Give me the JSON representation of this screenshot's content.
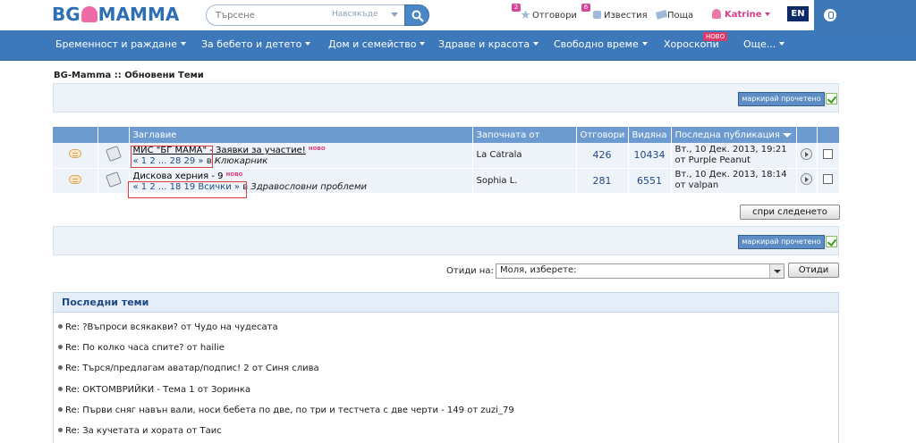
{
  "header": {
    "logo_text_left": "BG",
    "logo_text_right": "MAMMA",
    "search_placeholder": "Търсене",
    "search_scope": "Навсякъде",
    "replies_label": "Отговори",
    "replies_count": "2",
    "notifications_label": "Известия",
    "notifications_count": "6",
    "mail_label": "Поща",
    "user_name": "Katrine",
    "lang": "EN"
  },
  "nav": {
    "items": [
      "Бременност и раждане",
      "За бебето и детето",
      "Дом и семейство",
      "Здраве и красота",
      "Свободно време",
      "Хороскопи",
      "Още..."
    ],
    "new_badge": "НОВО"
  },
  "breadcrumb": "BG-Mamma :: Обновени Теми",
  "mark_read_label": "маркирай прочетено",
  "table": {
    "headers": {
      "title": "Заглавие",
      "started_by": "Започната от",
      "replies": "Отговори",
      "views": "Видяна",
      "last_post": "Последна публикация"
    },
    "rows": [
      {
        "title": "МИС \"БГ МАМА\" - Заявки за участие!",
        "new_tag": "ново",
        "pages": "« 1 2 ... 28 29 »",
        "forum_prefix": "в",
        "forum": "Клюкарник",
        "starter": "La Catrala",
        "replies": "426",
        "views": "10434",
        "last_date": "Вт., 10 Дек. 2013, 19:21",
        "last_by": "от Purple Peanut"
      },
      {
        "title": "Дискова херния - 9",
        "new_tag": "ново",
        "pages": "« 1 2 ... 18 19  Всички »",
        "forum_prefix": "в",
        "forum": "Здравословни проблеми",
        "starter": "Sophia L.",
        "replies": "281",
        "views": "6551",
        "last_date": "Вт., 10 Дек. 2013, 18:14",
        "last_by": "от valpan"
      }
    ]
  },
  "stop_following_label": "спри следенето",
  "goto": {
    "label": "Отиди на:",
    "selected": "Моля, изберете:",
    "button": "Отиди"
  },
  "latest": {
    "title": "Последни теми",
    "by_word": "от",
    "items": [
      {
        "text": "Re: ?Въпроси всякакви?",
        "author": "Чудо на чудесата"
      },
      {
        "text": "Re: По колко часа спите?",
        "author": "hailie"
      },
      {
        "text": "Re: Търся/предлагам аватар/подпис! 2",
        "author": "Синя слива"
      },
      {
        "text": "Re: ОКТОМВРИЙКИ - Тема 1",
        "author": "Зоринка"
      },
      {
        "text": "Re: Първи сняг навън вали, носи бебета по две, по три и тестчета с две черти - 149",
        "author": "zuzi_79"
      },
      {
        "text": "Re: За кучетата и хората",
        "author": "Таис"
      }
    ]
  }
}
